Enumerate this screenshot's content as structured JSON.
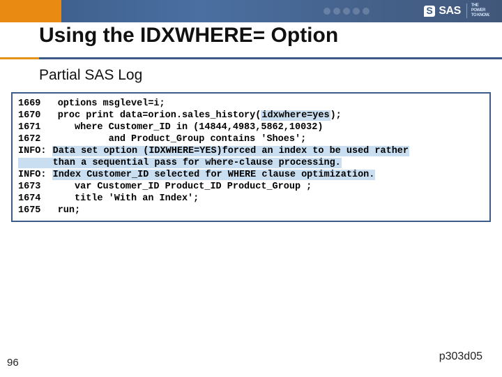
{
  "brand": {
    "name": "SAS",
    "tagline1": "THE",
    "tagline2": "POWER",
    "tagline3": "TO KNOW."
  },
  "title": "Using the IDXWHERE= Option",
  "subtitle": "Partial SAS Log",
  "code": {
    "l1_pre": "1669   options msglevel=i;",
    "l2_pre": "1670   proc print data=orion.sales_history(",
    "l2_hl": "idxwhere=yes",
    "l2_post": ");",
    "l3": "1671      where Customer_ID in (14844,4983,5862,10032)",
    "l4": "1672            and Product_Group contains 'Shoes';",
    "l5_pre": "INFO: ",
    "l5_hl": "Data set option (IDXWHERE=YES)forced an index to be used rather",
    "l6_hl": "      than a sequential pass for where-clause processing.",
    "l7_pre": "INFO: ",
    "l7_hl": "Index Customer_ID selected for WHERE clause optimization.",
    "l8": "1673      var Customer_ID Product_ID Product_Group ;",
    "l9": "1674      title 'With an Index';",
    "l10": "1675   run;"
  },
  "pagenum": "96",
  "footcode": "p303d05"
}
